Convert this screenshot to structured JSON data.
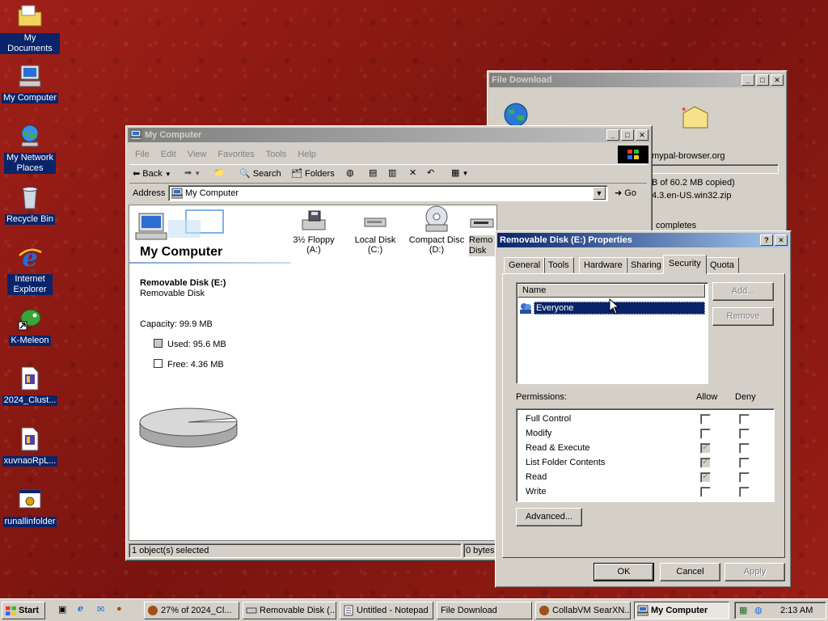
{
  "desktop_icons": [
    {
      "label": "My Documents"
    },
    {
      "label": "My Computer"
    },
    {
      "label": "My Network Places"
    },
    {
      "label": "Recycle Bin"
    },
    {
      "label": "Internet Explorer"
    },
    {
      "label": "K-Meleon"
    },
    {
      "label": "2024_Clust..."
    },
    {
      "label": "xuvnaoRpL..."
    },
    {
      "label": "runallinfolder"
    }
  ],
  "file_download": {
    "title": "File Download",
    "site": "mypal-browser.org",
    "progress_text": "B of 60.2 MB copied)",
    "file_text": "4.3.en-US.win32.zip",
    "note": "completes"
  },
  "mycomputer": {
    "title": "My Computer",
    "menu": [
      "File",
      "Edit",
      "View",
      "Favorites",
      "Tools",
      "Help"
    ],
    "toolbar": {
      "back": "Back",
      "search": "Search",
      "folders": "Folders"
    },
    "address_label": "Address",
    "address_value": "My Computer",
    "go": "Go",
    "banner_title": "My Computer",
    "selected_name": "Removable Disk (E:)",
    "selected_type": "Removable Disk",
    "capacity": "Capacity: 99.9 MB",
    "used": "Used: 95.6 MB",
    "free": "Free: 4.36 MB",
    "used_fraction": 0.957,
    "drives": [
      {
        "label": "3½ Floppy (A:)"
      },
      {
        "label": "Local Disk (C:)"
      },
      {
        "label": "Compact Disc (D:)"
      },
      {
        "label": "Remo Disk"
      }
    ],
    "status_left": "1 object(s) selected",
    "status_right": "0 bytes"
  },
  "props": {
    "title": "Removable Disk (E:) Properties",
    "tabs": [
      "General",
      "Tools",
      "Hardware",
      "Sharing",
      "Security",
      "Quota"
    ],
    "name_header": "Name",
    "user": "Everyone",
    "add": "Add...",
    "remove": "Remove",
    "permissions_label": "Permissions:",
    "allow": "Allow",
    "deny": "Deny",
    "permissions": [
      {
        "name": "Full Control",
        "allow": false
      },
      {
        "name": "Modify",
        "allow": false
      },
      {
        "name": "Read & Execute",
        "allow": true
      },
      {
        "name": "List Folder Contents",
        "allow": true
      },
      {
        "name": "Read",
        "allow": true
      },
      {
        "name": "Write",
        "allow": false
      }
    ],
    "advanced": "Advanced...",
    "ok": "OK",
    "cancel": "Cancel",
    "apply": "Apply"
  },
  "taskbar": {
    "start": "Start",
    "tasks": [
      {
        "label": "27% of 2024_Cl..."
      },
      {
        "label": "Removable Disk (..."
      },
      {
        "label": "Untitled - Notepad"
      },
      {
        "label": "File Download"
      },
      {
        "label": "CollabVM SearXN..."
      },
      {
        "label": "My Computer"
      }
    ],
    "clock": "2:13 AM"
  }
}
